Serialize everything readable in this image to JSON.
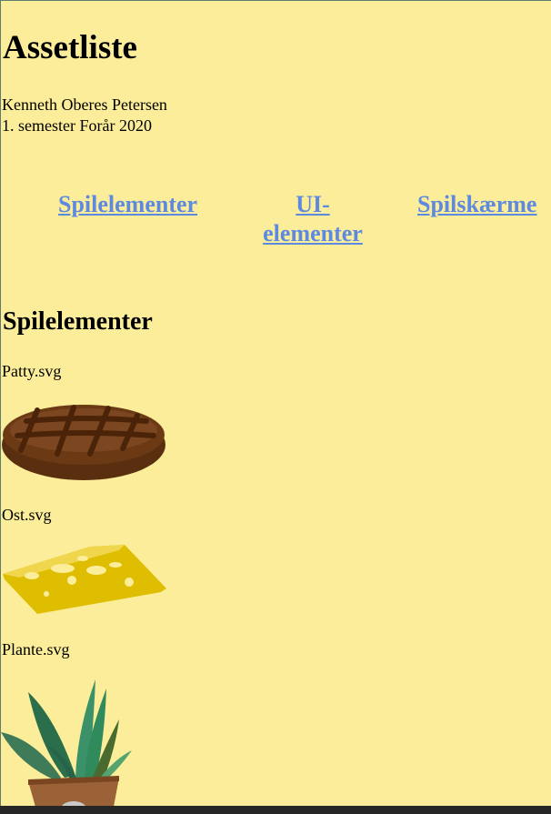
{
  "page": {
    "title": "Assetliste",
    "author": "Kenneth Oberes Petersen",
    "course": "1. semester Forår 2020"
  },
  "nav": {
    "links": [
      {
        "label": "Spilelementer"
      },
      {
        "label": "UI-elementer"
      },
      {
        "label": "Spilskærme"
      }
    ]
  },
  "section": {
    "title": "Spilelementer",
    "assets": [
      {
        "filename": "Patty.svg",
        "icon": "patty-icon"
      },
      {
        "filename": "Ost.svg",
        "icon": "cheese-icon"
      },
      {
        "filename": "Plante.svg",
        "icon": "plant-icon"
      }
    ]
  },
  "colors": {
    "background": "#fbed99",
    "link": "#5d8ae0",
    "patty": "#6b3a14",
    "cheese": "#dfbd00",
    "plant": "#2f8a5c",
    "pot": "#9a6236"
  }
}
